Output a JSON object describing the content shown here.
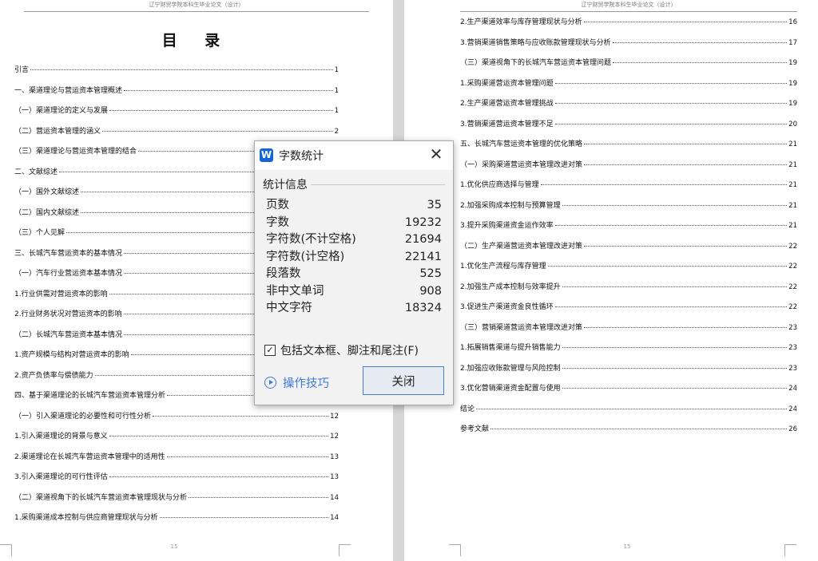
{
  "document": {
    "header_text": "辽宁财贸学院本科生毕业论文（设计）",
    "left_page": {
      "title": "目 录",
      "page_number": "15",
      "entries": [
        {
          "label": "引言",
          "page": "1"
        },
        {
          "label": "一、渠道理论与营运资本管理概述",
          "page": "1"
        },
        {
          "label": "（一）渠道理论的定义与发展",
          "page": "1"
        },
        {
          "label": "（二）营运资本管理的涵义",
          "page": "2"
        },
        {
          "label": "（三）渠道理论与营运资本管理的结合",
          "page": ""
        },
        {
          "label": "二、文献综述",
          "page": ""
        },
        {
          "label": "（一）国外文献综述",
          "page": ""
        },
        {
          "label": "（二）国内文献综述",
          "page": ""
        },
        {
          "label": "（三）个人见解",
          "page": ""
        },
        {
          "label": "三、长城汽车营运资本的基本情况",
          "page": ""
        },
        {
          "label": "（一）汽车行业营运资本基本情况",
          "page": ""
        },
        {
          "label": "1.行业供需对营运资本的影响",
          "page": ""
        },
        {
          "label": "2.行业财务状况对营运资本的影响",
          "page": ""
        },
        {
          "label": "（二）长城汽车营运资本基本情况",
          "page": ""
        },
        {
          "label": "1.资产规模与结构对营运资本的影响",
          "page": ""
        },
        {
          "label": "2.资产负债率与偿债能力",
          "page": ""
        },
        {
          "label": "四、基于渠道理论的长城汽车营运资本管理分析",
          "page": "12"
        },
        {
          "label": "（一）引入渠道理论的必要性和可行性分析",
          "page": "12"
        },
        {
          "label": "1.引入渠道理论的背景与意义",
          "page": "12"
        },
        {
          "label": "2.渠道理论在长城汽车营运资本管理中的适用性",
          "page": "13"
        },
        {
          "label": "3.引入渠道理论的可行性评估",
          "page": "13"
        },
        {
          "label": "（二）渠道视角下的长城汽车营运资本管理现状与分析",
          "page": "14"
        },
        {
          "label": "1.采购渠道成本控制与供应商管理现状与分析",
          "page": "14"
        }
      ]
    },
    "right_page": {
      "page_number": "15",
      "entries": [
        {
          "label": "2.生产渠道效率与库存管理现状与分析",
          "page": "16"
        },
        {
          "label": "3.营销渠道销售策略与应收账款管理现状与分析",
          "page": "17"
        },
        {
          "label": "（三）渠道视角下的长城汽车营运资本管理问题",
          "page": "19"
        },
        {
          "label": "1.采购渠道营运资本管理问题",
          "page": "19"
        },
        {
          "label": "2.生产渠道营运资本管理挑战",
          "page": "19"
        },
        {
          "label": "3.营销渠道营运资本管理不足",
          "page": "20"
        },
        {
          "label": "五、长城汽车营运资本管理的优化策略",
          "page": "21"
        },
        {
          "label": "（一）采购渠道营运资本管理改进对策",
          "page": "21"
        },
        {
          "label": "1.优化供应商选择与管理",
          "page": "21"
        },
        {
          "label": "2.加强采购成本控制与预算管理",
          "page": "21"
        },
        {
          "label": "3.提升采购渠道资金运作效率",
          "page": "21"
        },
        {
          "label": "（二）生产渠道营运资本管理改进对策",
          "page": "22"
        },
        {
          "label": "1.优化生产流程与库存管理",
          "page": "22"
        },
        {
          "label": "2.加强生产成本控制与效率提升",
          "page": "22"
        },
        {
          "label": "3.促进生产渠道资金良性循环",
          "page": "22"
        },
        {
          "label": "（三）营销渠道营运资本管理改进对策",
          "page": "23"
        },
        {
          "label": "1.拓展销售渠道与提升销售能力",
          "page": "23"
        },
        {
          "label": "2.加强应收账款管理与风险控制",
          "page": "23"
        },
        {
          "label": "3.优化营销渠道资金配置与使用",
          "page": "24"
        },
        {
          "label": "结论",
          "page": "24"
        },
        {
          "label": "参考文献",
          "page": "26"
        }
      ]
    }
  },
  "dialog": {
    "app_icon": "W",
    "title": "字数统计",
    "close_glyph": "✕",
    "section_label": "统计信息",
    "stats": [
      {
        "label": "页数",
        "value": "35"
      },
      {
        "label": "字数",
        "value": "19232"
      },
      {
        "label": "字符数(不计空格)",
        "value": "21694"
      },
      {
        "label": "字符数(计空格)",
        "value": "22141"
      },
      {
        "label": "段落数",
        "value": "525"
      },
      {
        "label": "非中文单词",
        "value": "908"
      },
      {
        "label": "中文字符",
        "value": "18324"
      }
    ],
    "include_checkbox": {
      "label": "包括文本框、脚注和尾注(F)",
      "checked": true,
      "mark": "✓"
    },
    "tips_label": "操作技巧",
    "close_button_label": "关闭"
  }
}
